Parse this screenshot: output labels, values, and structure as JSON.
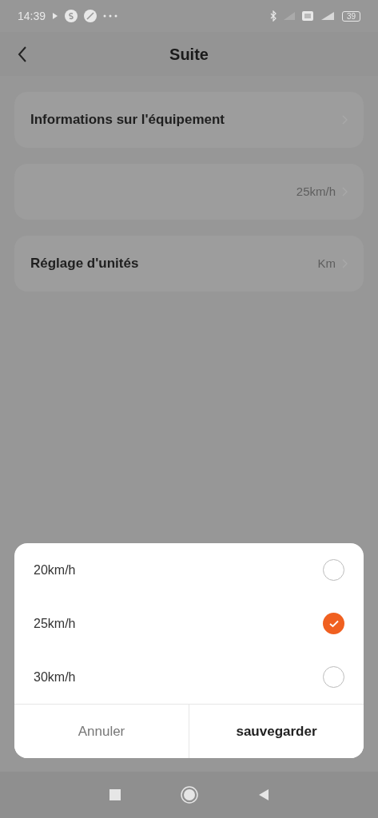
{
  "status_bar": {
    "time": "14:39",
    "battery": "39"
  },
  "header": {
    "title": "Suite"
  },
  "settings": [
    {
      "label": "Informations sur l'équipement"
    },
    {
      "value": "25km/h"
    },
    {
      "label": "Réglage d'unités",
      "value": "Km"
    }
  ],
  "speed_sheet": {
    "options": [
      {
        "label": "20km/h",
        "selected": false
      },
      {
        "label": "25km/h",
        "selected": true
      },
      {
        "label": "30km/h",
        "selected": false
      }
    ],
    "buttons": [
      {
        "label": "Annuler",
        "kind": "cancel"
      },
      {
        "label": "sauvegarder",
        "kind": "confirm"
      }
    ]
  }
}
